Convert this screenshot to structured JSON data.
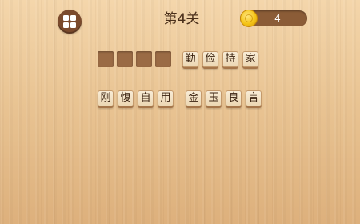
{
  "header": {
    "level_title": "第4关",
    "coin_count": "4",
    "menu_icon": "grid-menu-icon"
  },
  "puzzle": {
    "answer_slots": 4,
    "given_chars": [
      "勤",
      "俭",
      "持",
      "家"
    ]
  },
  "choices": {
    "chars": [
      "刚",
      "愎",
      "自",
      "用",
      "金",
      "玉",
      "良",
      "言"
    ]
  },
  "colors": {
    "menu_button": "#7b4a2c",
    "coin_pill": "#8b5c37",
    "answer_slot": "#9a6b45",
    "tile_face": "#f3e3c6",
    "title_text": "#4a2f1a"
  }
}
